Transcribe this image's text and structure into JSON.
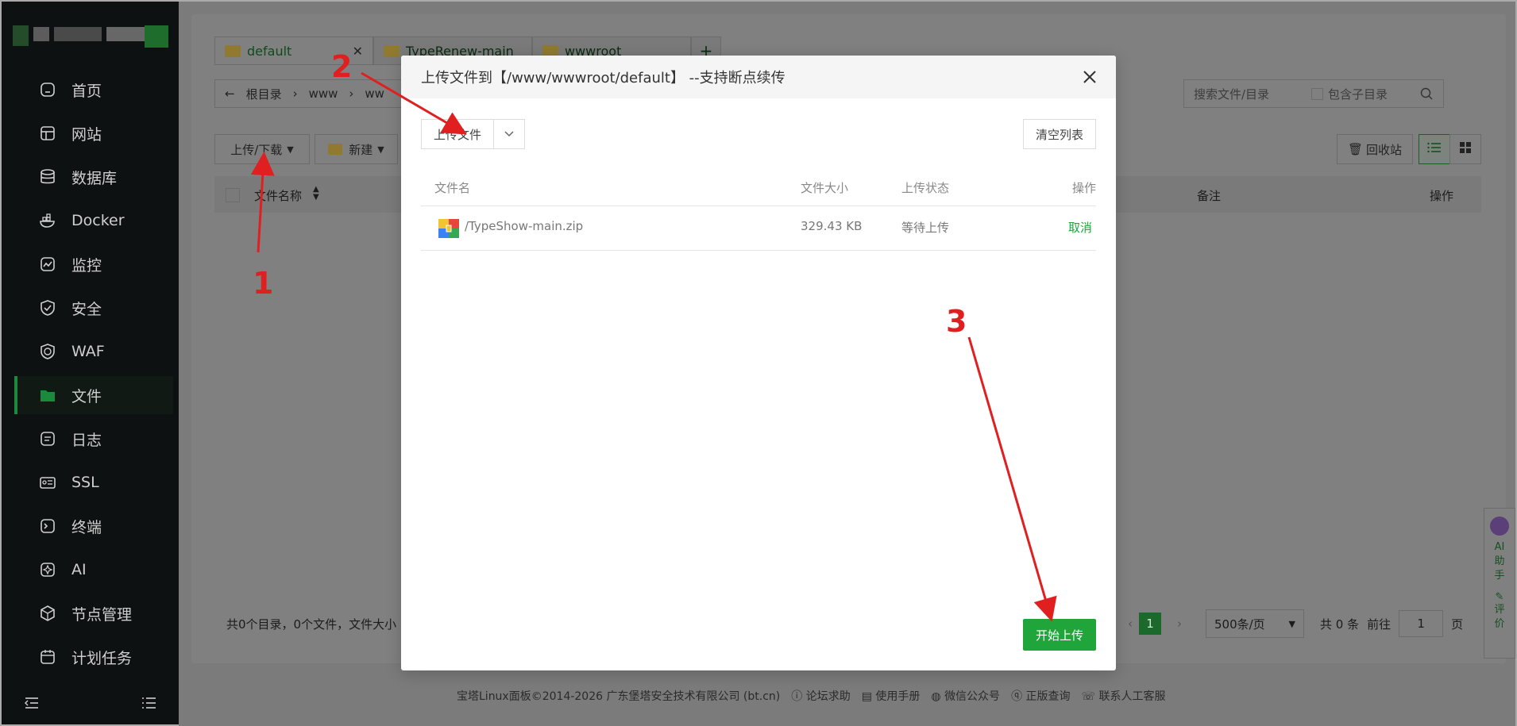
{
  "sidebar": {
    "items": [
      {
        "label": "首页",
        "icon": "home-icon"
      },
      {
        "label": "网站",
        "icon": "globe-icon"
      },
      {
        "label": "数据库",
        "icon": "database-icon"
      },
      {
        "label": "Docker",
        "icon": "docker-icon"
      },
      {
        "label": "监控",
        "icon": "monitor-icon"
      },
      {
        "label": "安全",
        "icon": "shield-icon"
      },
      {
        "label": "WAF",
        "icon": "waf-icon"
      },
      {
        "label": "文件",
        "icon": "folder-icon",
        "active": true
      },
      {
        "label": "日志",
        "icon": "log-icon"
      },
      {
        "label": "SSL",
        "icon": "ssl-icon"
      },
      {
        "label": "终端",
        "icon": "terminal-icon"
      },
      {
        "label": "AI",
        "icon": "ai-icon"
      },
      {
        "label": "节点管理",
        "icon": "node-icon"
      },
      {
        "label": "计划任务",
        "icon": "calendar-icon"
      }
    ]
  },
  "tabs": [
    {
      "label": "default"
    },
    {
      "label": "TypeRenew-main"
    },
    {
      "label": "wwwroot"
    }
  ],
  "tab_add": "+",
  "breadcrumb": {
    "root": "根目录",
    "seg1": "www",
    "seg2": "ww"
  },
  "search": {
    "placeholder": "搜索文件/目录",
    "subdir": "包含子目录"
  },
  "toolbar": {
    "upload_download": "上传/下载",
    "new": "新建",
    "recycle": "回收站"
  },
  "table": {
    "col_name": "文件名称",
    "col_note": "备注",
    "col_op": "操作"
  },
  "footer": {
    "summary": "共0个目录，0个文件，文件大小",
    "page": "1",
    "per_page": "500条/页",
    "total": "共 0 条",
    "goto": "前往",
    "goto_value": "1",
    "page_unit": "页"
  },
  "copyright": {
    "text": "宝塔Linux面板©2014-2026 广东堡塔安全技术有限公司 (bt.cn)",
    "forum": "论坛求助",
    "manual": "使用手册",
    "wechat": "微信公众号",
    "verify": "正版查询",
    "support": "联系人工客服"
  },
  "ai_side": {
    "assistant": "AI助手",
    "rate": "评价"
  },
  "modal": {
    "title": "上传文件到【/www/wwwroot/default】 --支持断点续传",
    "upload_btn": "上传文件",
    "clear_btn": "清空列表",
    "columns": {
      "name": "文件名",
      "size": "文件大小",
      "status": "上传状态",
      "op": "操作"
    },
    "files": [
      {
        "name": "/TypeShow-main.zip",
        "size": "329.43 KB",
        "status": "等待上传",
        "op": "取消"
      }
    ],
    "start_btn": "开始上传"
  },
  "annotations": {
    "n1": "1",
    "n2": "2",
    "n3": "3"
  },
  "colors": {
    "accent": "#20a53a",
    "annotation": "#e02020"
  }
}
